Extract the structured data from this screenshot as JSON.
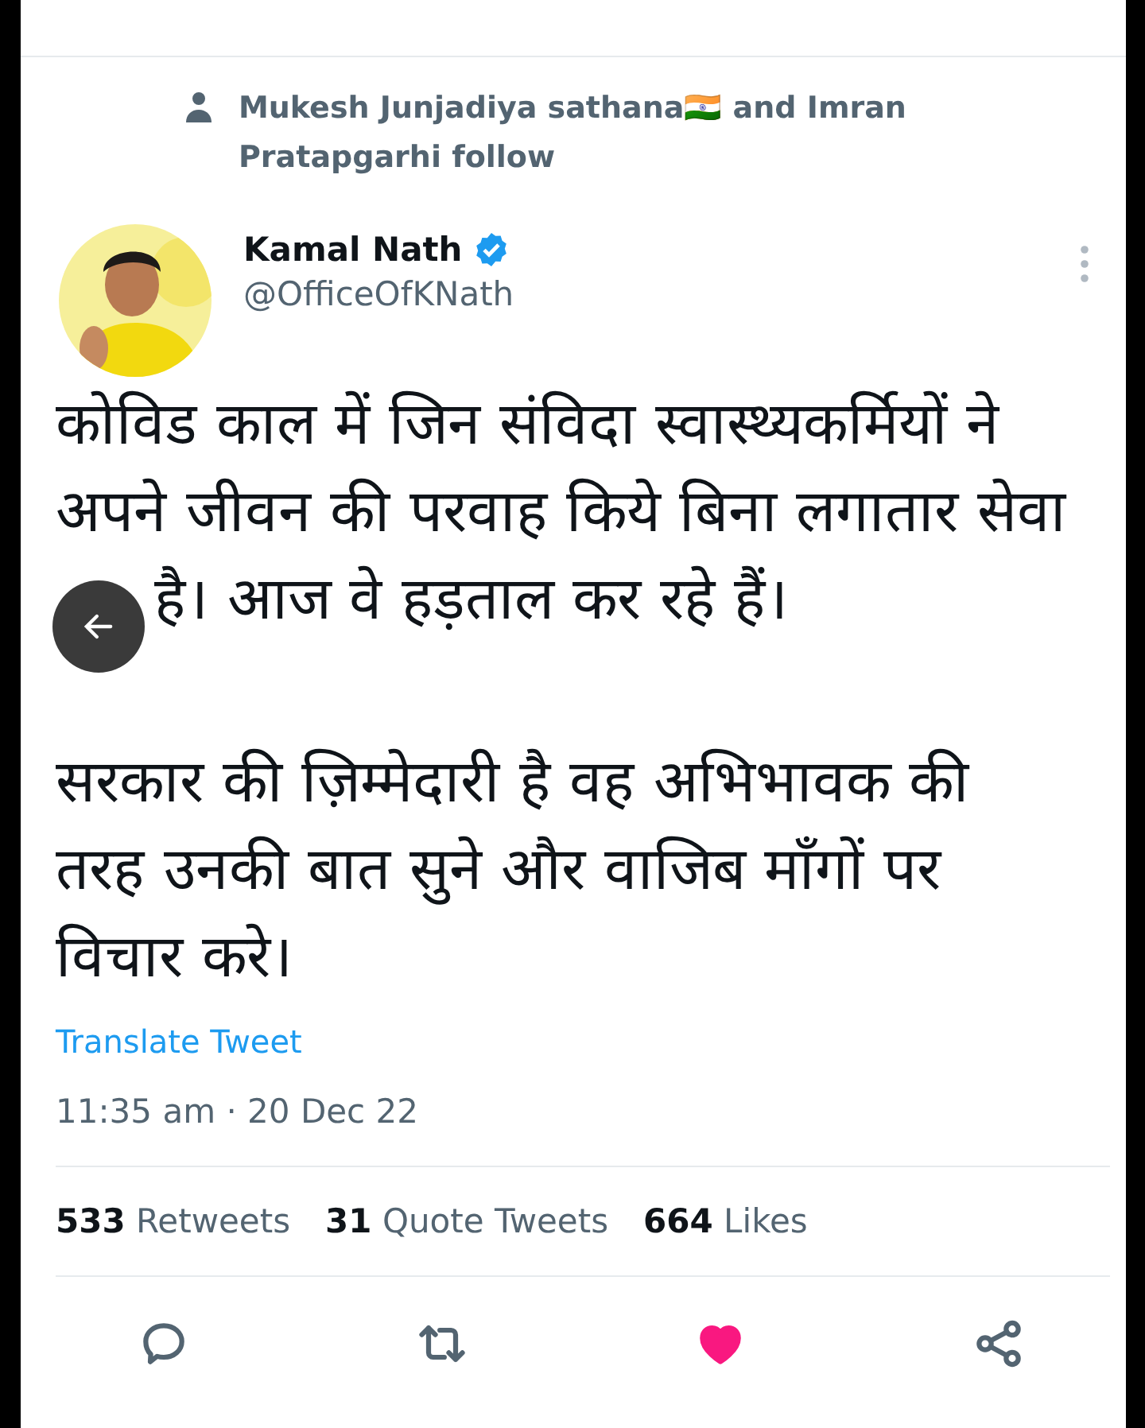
{
  "social_context": {
    "text": "Mukesh Junjadiya sathana🇮🇳 and Imran Pratapgarhi follow"
  },
  "author": {
    "name": "Kamal Nath",
    "verified": true,
    "handle": "@OfficeOfKNath"
  },
  "tweet": {
    "paragraphs": [
      {
        "lines": [
          "कोविड काल में जिन संविदा स्वास्थ्यकर्मियों ने",
          "अपने जीवन की परवाह किये बिना लगातार सेवा",
          "है। आज वे हड़ताल कर रहे हैं।"
        ]
      },
      {
        "lines": [
          "सरकार की ज़िम्मेदारी है वह अभिभावक की",
          "तरह उनकी बात सुने और वाजिब माँगों पर",
          "विचार करे।"
        ]
      }
    ],
    "translate_link": "Translate Tweet",
    "timestamp": "11:35 am · 20 Dec 22"
  },
  "stats": [
    {
      "count": "533",
      "label": "Retweets"
    },
    {
      "count": "31",
      "label": "Quote Tweets"
    },
    {
      "count": "664",
      "label": "Likes"
    }
  ],
  "actions": [
    {
      "kind": "reply",
      "active": false
    },
    {
      "kind": "retweet",
      "active": false
    },
    {
      "kind": "like",
      "active": true
    },
    {
      "kind": "share",
      "active": false
    }
  ]
}
